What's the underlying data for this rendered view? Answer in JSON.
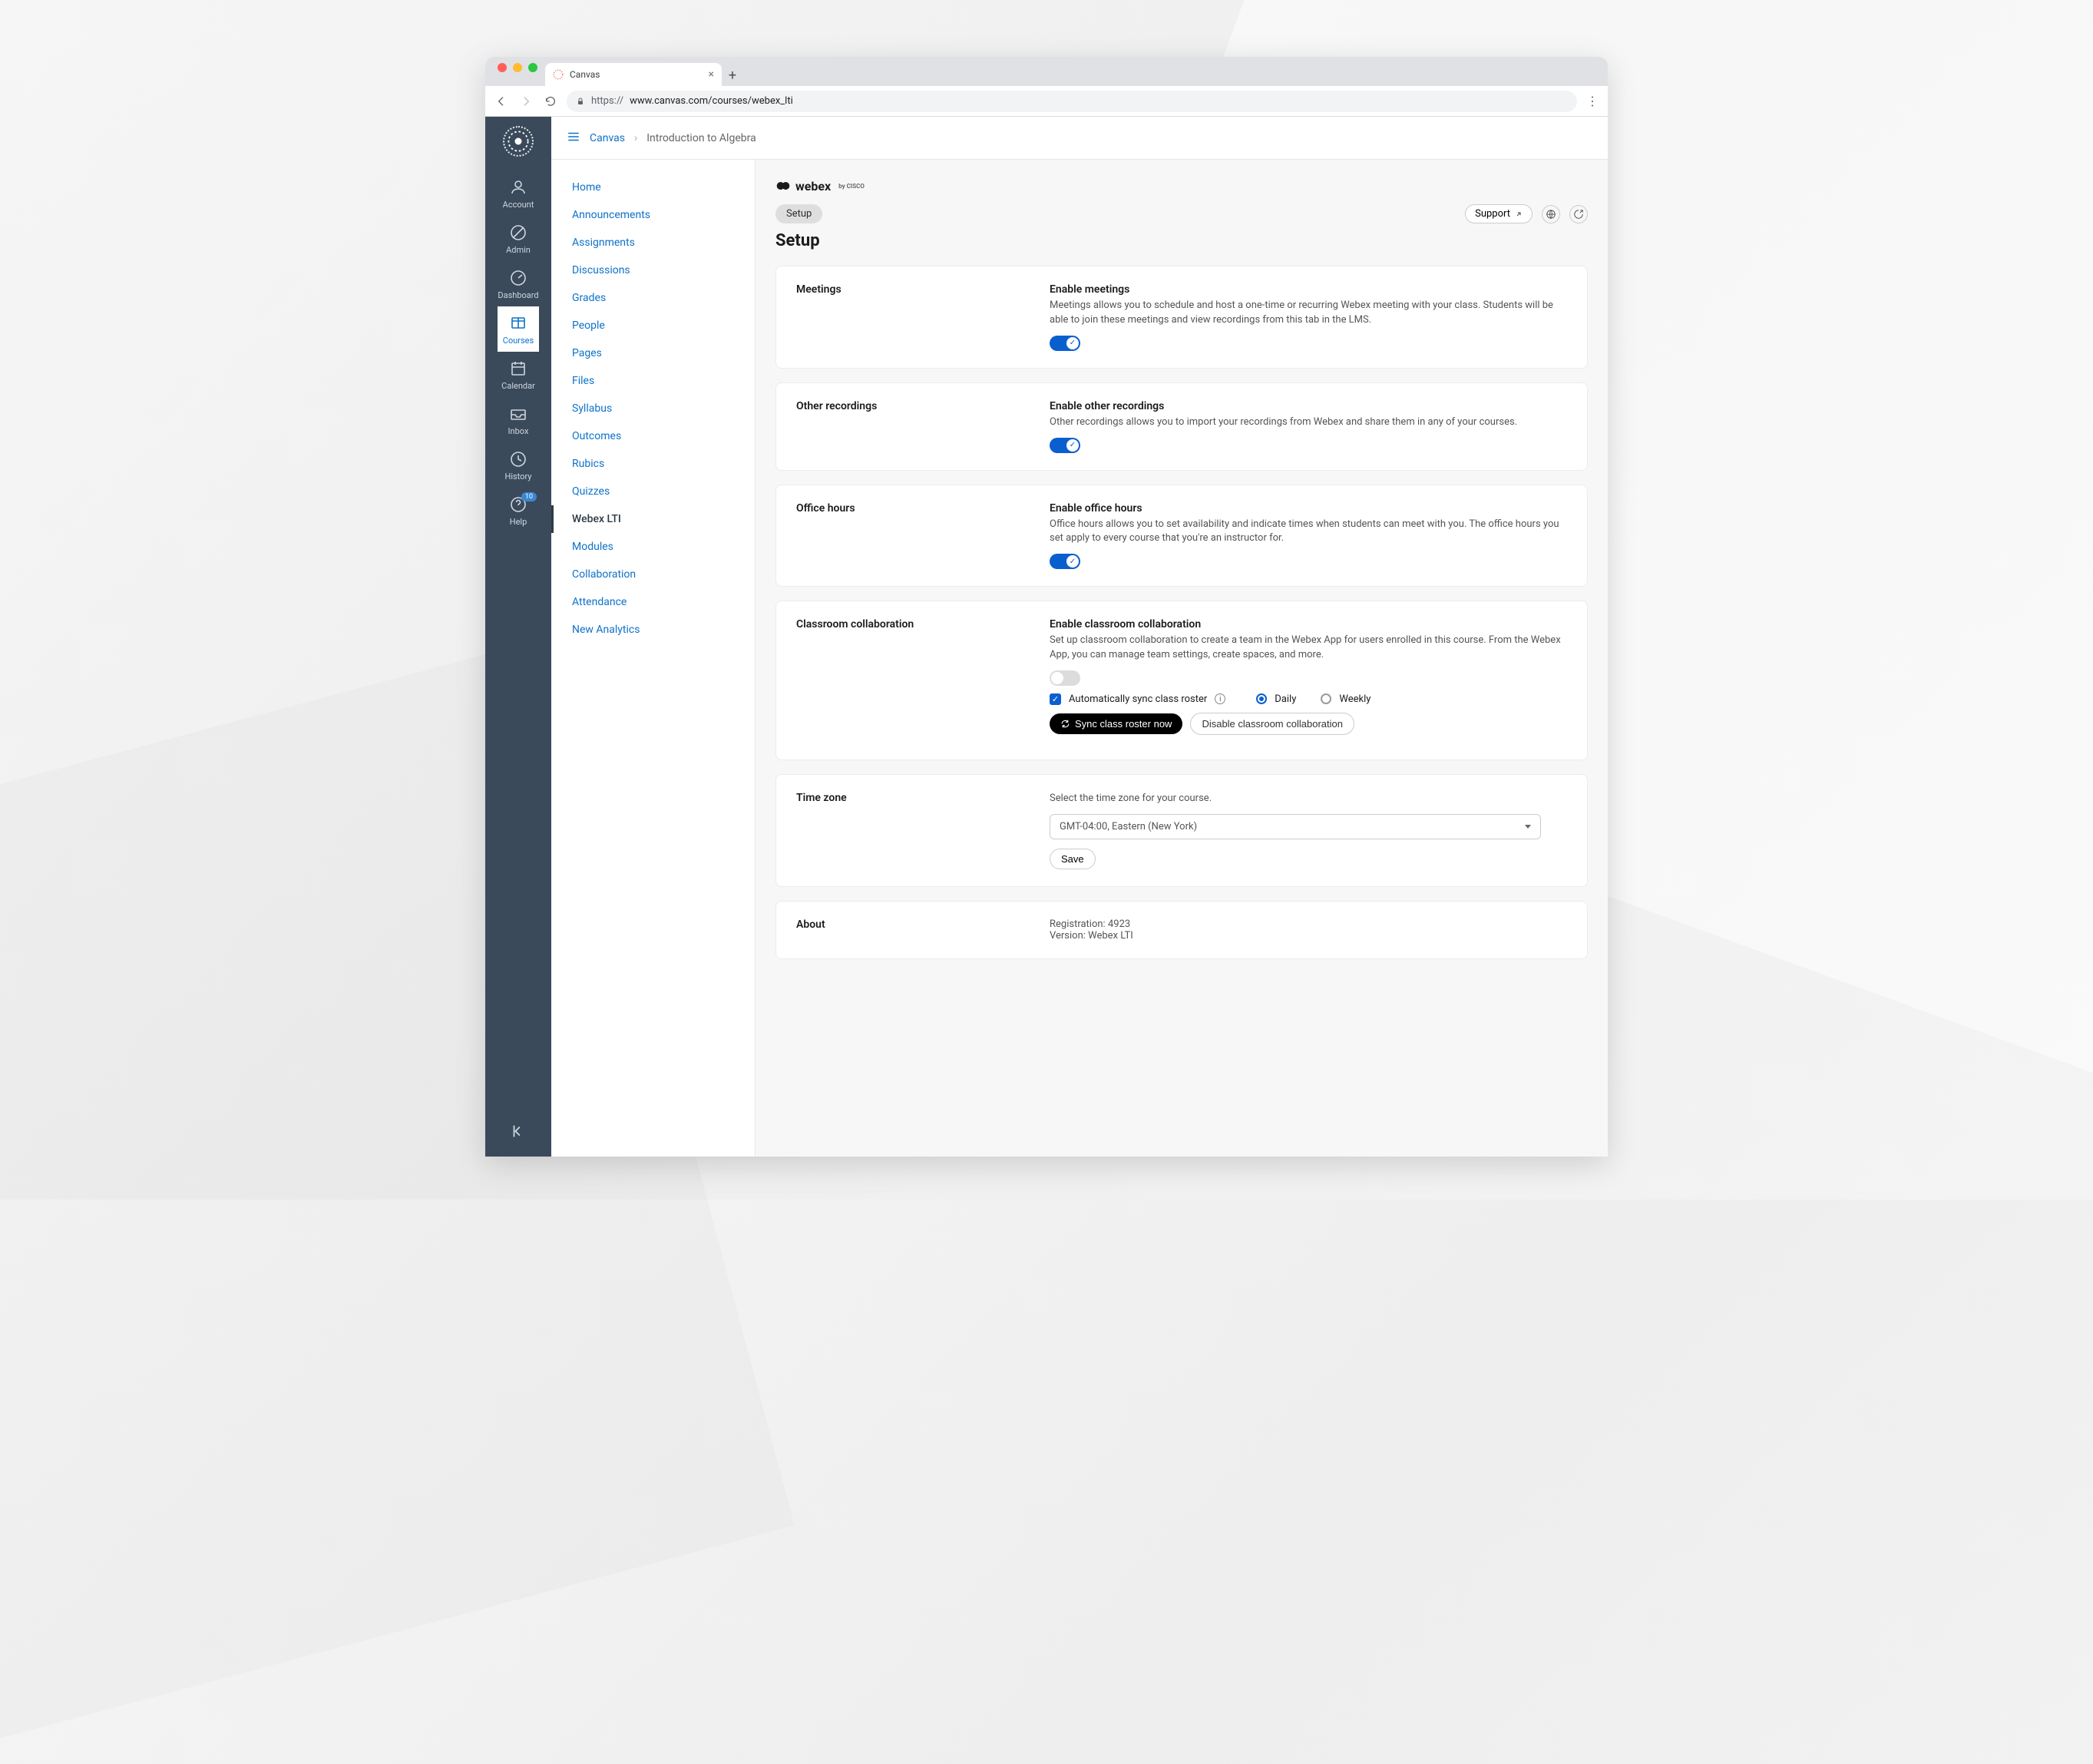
{
  "browser": {
    "tab_title": "Canvas",
    "url_scheme": "https://",
    "url_host": "www.canvas.com/courses/webex_lti"
  },
  "global_nav": {
    "items": [
      {
        "label": "Account",
        "icon": "account"
      },
      {
        "label": "Admin",
        "icon": "admin"
      },
      {
        "label": "Dashboard",
        "icon": "dashboard"
      },
      {
        "label": "Courses",
        "icon": "courses",
        "active": true
      },
      {
        "label": "Calendar",
        "icon": "calendar"
      },
      {
        "label": "Inbox",
        "icon": "inbox"
      },
      {
        "label": "History",
        "icon": "history"
      },
      {
        "label": "Help",
        "icon": "help",
        "badge": "10"
      }
    ]
  },
  "breadcrumb": {
    "root": "Canvas",
    "current": "Introduction to Algebra"
  },
  "course_nav": [
    "Home",
    "Announcements",
    "Assignments",
    "Discussions",
    "Grades",
    "People",
    "Pages",
    "Files",
    "Syllabus",
    "Outcomes",
    "Rubics",
    "Quizzes",
    "Webex LTI",
    "Modules",
    "Collaboration",
    "Attendance",
    "New Analytics"
  ],
  "course_nav_active": "Webex LTI",
  "tool": {
    "brand": "webex",
    "brand_sub": "by CISCO",
    "tabs": [
      "Setup"
    ],
    "support_label": "Support",
    "page_title": "Setup"
  },
  "cards": {
    "meetings": {
      "section": "Meetings",
      "title": "Enable meetings",
      "body": "Meetings allows you to schedule and host a one-time or recurring Webex meeting with your class. Students will be able to join these meetings and view recordings from this tab in the LMS.",
      "enabled": true
    },
    "other_recordings": {
      "section": "Other recordings",
      "title": "Enable other recordings",
      "body": "Other recordings allows you to import your recordings from Webex and share them in any of your courses.",
      "enabled": true
    },
    "office_hours": {
      "section": "Office hours",
      "title": "Enable office hours",
      "body": "Office hours allows you to set availability and indicate times when students can meet with you. The office hours you set apply to every course that you're an instructor for.",
      "enabled": true
    },
    "classroom": {
      "section": "Classroom collaboration",
      "title": "Enable classroom collaboration",
      "body": "Set up classroom collaboration to create a team in the Webex App for users enrolled in this course. From the Webex App, you can manage team settings, create spaces, and more.",
      "enabled": false,
      "autosync_label": "Automatically sync class roster",
      "freq_daily": "Daily",
      "freq_weekly": "Weekly",
      "btn_sync": "Sync class roster now",
      "btn_disable": "Disable classroom collaboration"
    },
    "timezone": {
      "section": "Time zone",
      "hint": "Select the time zone for your course.",
      "selected": "GMT-04:00, Eastern (New York)",
      "save": "Save"
    },
    "about": {
      "section": "About",
      "registration_label": "Registration:",
      "registration_value": "4923",
      "version_label": "Version:",
      "version_value": "Webex LTI"
    }
  }
}
